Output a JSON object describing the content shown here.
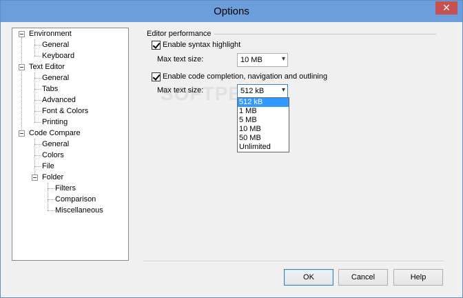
{
  "window": {
    "title": "Options",
    "close_glyph": "✕"
  },
  "tree": {
    "items": [
      {
        "label": "Environment"
      },
      {
        "label": "General"
      },
      {
        "label": "Keyboard"
      },
      {
        "label": "Text Editor"
      },
      {
        "label": "General"
      },
      {
        "label": "Tabs"
      },
      {
        "label": "Advanced"
      },
      {
        "label": "Font & Colors"
      },
      {
        "label": "Printing"
      },
      {
        "label": "Code Compare"
      },
      {
        "label": "General"
      },
      {
        "label": "Colors"
      },
      {
        "label": "File"
      },
      {
        "label": "Folder"
      },
      {
        "label": "Filters"
      },
      {
        "label": "Comparison"
      },
      {
        "label": "Miscellaneous"
      }
    ]
  },
  "editor_performance": {
    "group_label": "Editor performance",
    "syntax_highlight_label": "Enable syntax highlight",
    "syntax_max_label": "Max text size:",
    "syntax_max_value": "10 MB",
    "code_completion_label": "Enable code completion, navigation and outlining",
    "completion_max_label": "Max text size:",
    "completion_max_value": "512 kB",
    "dropdown_options": [
      "512 kB",
      "1 MB",
      "5 MB",
      "10 MB",
      "50 MB",
      "Unlimited"
    ],
    "selected_option": "512 kB"
  },
  "buttons": {
    "ok": "OK",
    "cancel": "Cancel",
    "help": "Help"
  },
  "watermark": "SOFTPEDIA"
}
